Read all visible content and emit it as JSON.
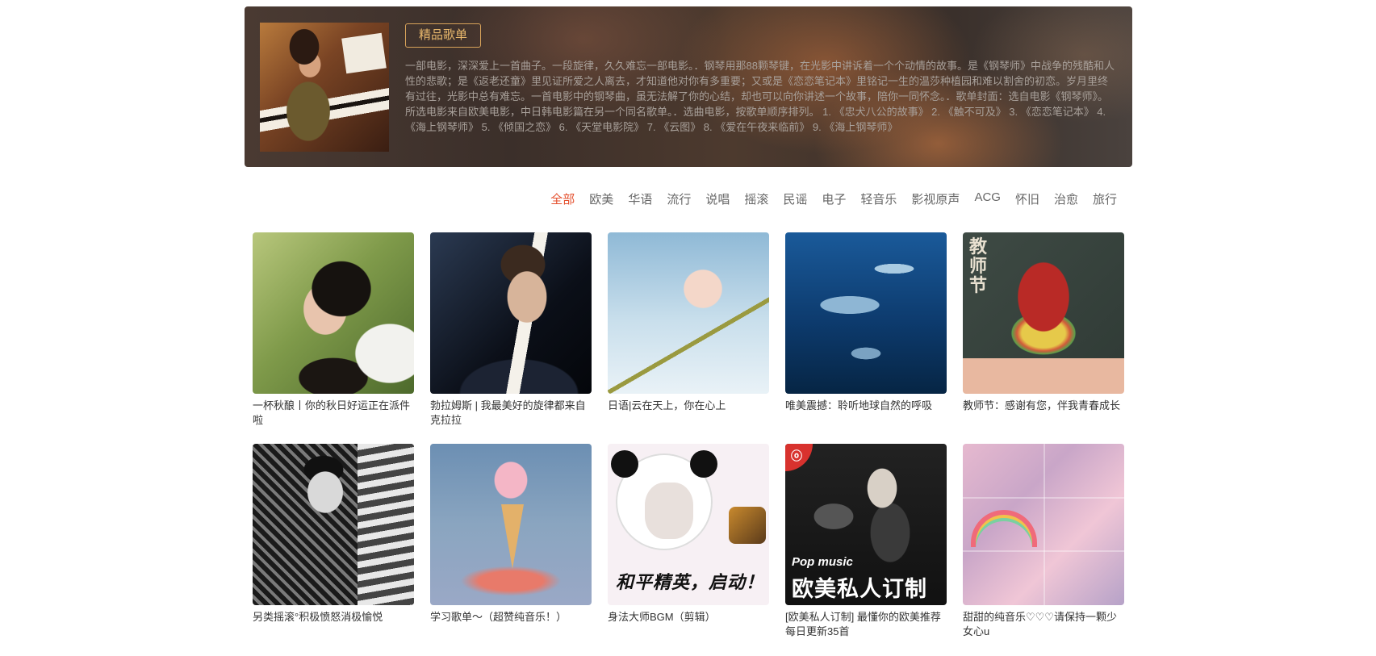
{
  "banner": {
    "tag": "精品歌单",
    "description": "一部电影，深深爱上一首曲子。一段旋律，久久难忘一部电影。．钢琴用那88颗琴键，在光影中讲诉着一个个动情的故事。是《钢琴师》中战争的残酷和人性的悲歌；是《返老还童》里见证所爱之人离去，才知道他对你有多重要；又或是《恋恋笔记本》里铭记一生的温莎种植园和难以割舍的初恋。岁月里终有过往，光影中总有难忘。一首电影中的钢琴曲，虽无法解了你的心结，却也可以向你讲述一个故事，陪你一同怀念。．歌单封面：选自电影《钢琴师》。所选电影来自欧美电影，中日韩电影篇在另一个同名歌单。．选曲电影，按歌单顺序排列。 1. 《忠犬八公的故事》 2. 《触不可及》 3. 《恋恋笔记本》 4. 《海上钢琴师》 5. 《倾国之恋》 6. 《天堂电影院》 7. 《云图》 8. 《爱在午夜来临前》 9. 《海上钢琴师》"
  },
  "tabs": [
    "全部",
    "欧美",
    "华语",
    "流行",
    "说唱",
    "摇滚",
    "民谣",
    "电子",
    "轻音乐",
    "影视原声",
    "ACG",
    "怀旧",
    "治愈",
    "旅行"
  ],
  "active_tab": "全部",
  "playlists": [
    {
      "title": "一杯秋酿丨你的秋日好运正在派件啦"
    },
    {
      "title": "勃拉姆斯 | 我最美好的旋律都来自克拉拉"
    },
    {
      "title": "日语|云在天上，你在心上"
    },
    {
      "title": "唯美震撼：聆听地球自然的呼吸"
    },
    {
      "title": "教师节：感谢有您，伴我青春成长"
    },
    {
      "title": "另类摇滚°积极愤怒消极愉悦"
    },
    {
      "title": "学习歌单～（超赞纯音乐！）"
    },
    {
      "title": "身法大师BGM（剪辑）"
    },
    {
      "title": "[欧美私人订制] 最懂你的欧美推荐 每日更新35首"
    },
    {
      "title": "甜甜的纯音乐♡♡♡请保持一颗少女心u"
    }
  ],
  "cover_text": {
    "teacher_day": "教师节",
    "panda_caption": "和平精英，启动！",
    "pop_label": "Pop music",
    "pop_title": "欧美私人订制",
    "badge": "ⓞ"
  },
  "colors": {
    "accent": "#e4502e",
    "tag_gold": "#e9b86c"
  }
}
